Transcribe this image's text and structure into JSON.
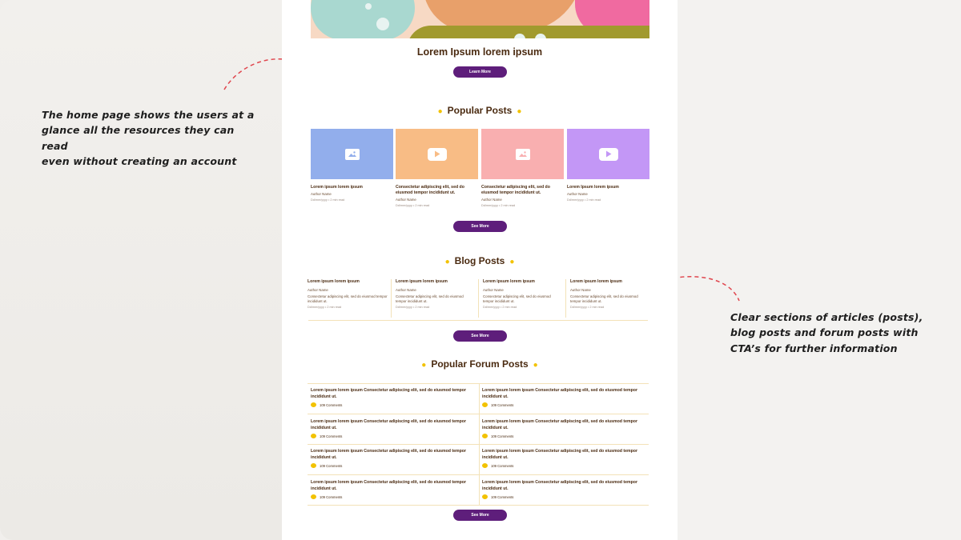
{
  "hero": {
    "title": "Lorem Ipsum lorem  ipsum",
    "cta": "Learn More"
  },
  "popular_posts": {
    "heading": "Popular Posts",
    "cta": "See More",
    "cards": [
      {
        "title": "Lorem ipsum lorem ipsum",
        "author": "Author Name",
        "meta": "Dd/mm/yyyy • 2 min read",
        "thumb_color": "#92aeec",
        "thumb_icon": "image-icon"
      },
      {
        "title": "Consectetur adipiscing elit, sed do eiusmod tempor incididunt ut.",
        "author": "Author Name",
        "meta": "Dd/mm/yyyy • 2 min read",
        "thumb_color": "#f8bc85",
        "thumb_icon": "play-icon"
      },
      {
        "title": "Consectetur adipiscing elit, sed do eiusmod tempor incididunt ut.",
        "author": "Author Name",
        "meta": "Dd/mm/yyyy • 2 min read",
        "thumb_color": "#f9afb0",
        "thumb_icon": "image-icon"
      },
      {
        "title": "Lorem Ipsum lorem ipsum",
        "author": "Author Name",
        "meta": "Dd/mm/yyyy • 2 min read",
        "thumb_color": "#c397f6",
        "thumb_icon": "play-icon"
      }
    ]
  },
  "blog_posts": {
    "heading": "Blog Posts",
    "cta": "See More",
    "items": [
      {
        "title": "Lorem ipsum lorem ipsum",
        "author": "Author Name",
        "desc": "Consectetur adipiscing elit, sed do eiusmod tempor incididunt ut.",
        "meta": "Dd/mm/yyyy • 2 min read"
      },
      {
        "title": "Lorem ipsum lorem ipsum",
        "author": "Author Name",
        "desc": "Consectetur adipiscing elit, sed do eiusmod tempor incididunt ut.",
        "meta": "Dd/mm/yyyy • 2 min read"
      },
      {
        "title": "Lorem ipsum lorem ipsum",
        "author": "Author Name",
        "desc": "Consectetur adipiscing elit, sed do eiusmod tempor incididunt ut.",
        "meta": "Dd/mm/yyyy • 2 min read"
      },
      {
        "title": "Lorem ipsum lorem ipsum",
        "author": "Author Name",
        "desc": "Consectetur adipiscing elit, sed do eiusmod tempor incididunt ut.",
        "meta": "Dd/mm/yyyy • 2 min read"
      }
    ]
  },
  "forum_posts": {
    "heading": "Popular Forum Posts",
    "cta": "See More",
    "items": [
      {
        "title": "Lorem ipsum lorem ipsum Consectetur adipiscing elit, sed do eiusmod tempor incididunt ut.",
        "comments": "109 Comments"
      },
      {
        "title": "Lorem ipsum lorem ipsum Consectetur adipiscing elit, sed do eiusmod tempor incididunt ut.",
        "comments": "109 Comments"
      },
      {
        "title": "Lorem ipsum lorem ipsum Consectetur adipiscing elit, sed do eiusmod tempor incididunt ut.",
        "comments": "109 Comments"
      },
      {
        "title": "Lorem ipsum lorem ipsum Consectetur adipiscing elit, sed do eiusmod tempor incididunt ut.",
        "comments": "109 Comments"
      },
      {
        "title": "Lorem ipsum lorem ipsum Consectetur adipiscing elit, sed do eiusmod tempor incididunt ut.",
        "comments": "109 Comments"
      },
      {
        "title": "Lorem ipsum lorem ipsum Consectetur adipiscing elit, sed do eiusmod tempor incididunt ut.",
        "comments": "109 Comments"
      },
      {
        "title": "Lorem ipsum lorem ipsum Consectetur adipiscing elit, sed do eiusmod tempor incididunt ut.",
        "comments": "109 Comments"
      },
      {
        "title": "Lorem ipsum lorem ipsum Consectetur adipiscing elit, sed do eiusmod tempor incididunt ut.",
        "comments": "109 Comments"
      }
    ]
  },
  "annotations": {
    "left": [
      "The home page shows the users at a",
      "glance all the resources they can read",
      "even without creating an account"
    ],
    "right": [
      "Clear sections of articles (posts),",
      "blog posts and forum posts with",
      "CTA’s for further information"
    ]
  },
  "colors": {
    "primary_button": "#5e1e7b",
    "accent_bullet": "#f2c200",
    "heading_text": "#4a2a10",
    "annotation_arrow": "#e0464e"
  }
}
